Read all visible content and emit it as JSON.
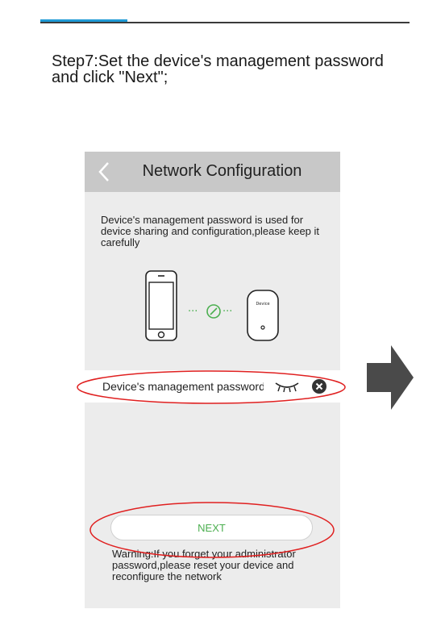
{
  "step": {
    "line1": "Step7:Set the device's management password",
    "line2": "and click \"Next\";"
  },
  "screen": {
    "nav_title": "Network Configuration",
    "description": "Device's management password is used for device sharing and configuration,please keep it carefully",
    "device_label": "Device",
    "password_placeholder": "Device's management password",
    "next_label": "NEXT",
    "warning": "Warning:If you forget your administrator password,please reset your device and reconfigure the network"
  },
  "icons": {
    "back": "chevron-left-icon",
    "phone": "smartphone-icon",
    "link": "link-icon",
    "device": "router-device-icon",
    "eye": "eye-closed-icon",
    "clear": "clear-circle-icon",
    "arrow": "right-arrow-icon"
  },
  "colors": {
    "accent_blue": "#1f9ad6",
    "navbar_gray": "#c8c8c8",
    "screen_bg": "#ececec",
    "link_green": "#4caf50",
    "highlight_red": "#e02020",
    "arrow_gray": "#4a4a4a"
  }
}
